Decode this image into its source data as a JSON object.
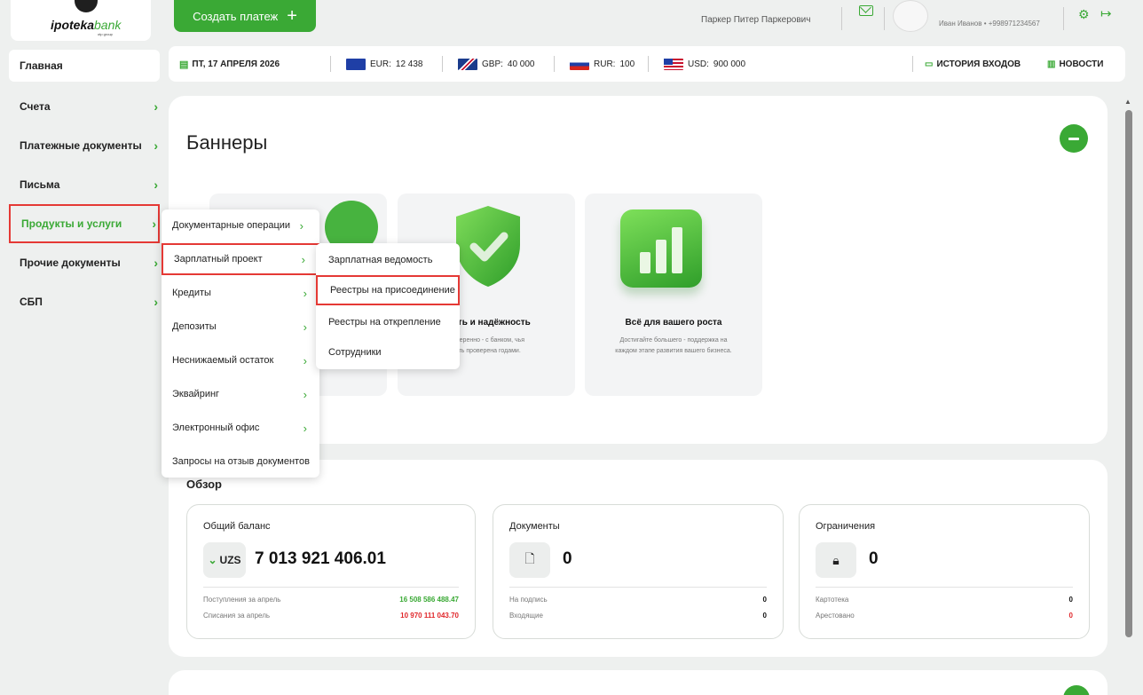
{
  "header": {
    "logo_text_bold": "ipoteka",
    "logo_text_light": "bank",
    "logo_sub": "otp group",
    "create_payment_label": "Создать платеж",
    "create_payment_icon": "plus-icon",
    "user_name": "Паркер Питер Паркерович",
    "account_line": "Иван Иванов • +998971234567"
  },
  "sidebar": {
    "main": "Главная",
    "items": [
      {
        "label": "Счета"
      },
      {
        "label": "Платежные документы"
      },
      {
        "label": "Письма"
      },
      {
        "label": "Продукты и услуги"
      },
      {
        "label": "Прочие документы"
      },
      {
        "label": "СБП"
      }
    ]
  },
  "infobar": {
    "date": "ПТ, 17 АПРЕЛЯ 2026",
    "currencies": [
      {
        "code": "EUR:",
        "value": "12 438"
      },
      {
        "code": "GBP:",
        "value": "40 000"
      },
      {
        "code": "RUR:",
        "value": "100"
      },
      {
        "code": "USD:",
        "value": "900 000"
      }
    ],
    "history_label": "ИСТОРИЯ ВХОДОВ",
    "news_label": "НОВОСТИ"
  },
  "banners": {
    "title": "Баннеры",
    "cards": [
      {
        "title": "",
        "text": ""
      },
      {
        "title": "ность и надёжность",
        "text": "ь уверенно - с банком, чья\nость проверена годами."
      },
      {
        "title": "Всё для вашего роста",
        "text": "Достигайте большего - поддержка на\nкаждом этапе развития вашего бизнеса."
      }
    ]
  },
  "overview": {
    "title": "Обзор",
    "balance": {
      "label": "Общий баланс",
      "currency": "UZS",
      "amount": "7 013 921 406.01",
      "rows": [
        {
          "label": "Поступления за апрель",
          "value": "16 508 586 488.47"
        },
        {
          "label": "Списания за апрель",
          "value": "10 970 111 043.70"
        }
      ]
    },
    "documents": {
      "label": "Документы",
      "count": "0",
      "rows": [
        {
          "label": "На подпись",
          "value": "0"
        },
        {
          "label": "Входящие",
          "value": "0"
        }
      ]
    },
    "restrictions": {
      "label": "Ограничения",
      "count": "0",
      "rows": [
        {
          "label": "Картотека",
          "value": "0"
        },
        {
          "label": "Арестовано",
          "value": "0"
        }
      ]
    }
  },
  "menu_products": {
    "items": [
      {
        "label": "Документарные операции"
      },
      {
        "label": "Зарплатный проект"
      },
      {
        "label": "Кредиты"
      },
      {
        "label": "Депозиты"
      },
      {
        "label": "Неснижаемый остаток"
      },
      {
        "label": "Эквайринг"
      },
      {
        "label": "Электронный офис"
      },
      {
        "label": "Запросы на отзыв документов"
      }
    ]
  },
  "menu_salary": {
    "items": [
      {
        "label": "Зарплатная ведомость"
      },
      {
        "label": "Реестры на присоединение"
      },
      {
        "label": "Реестры на открепление"
      },
      {
        "label": "Сотрудники"
      }
    ]
  },
  "colors": {
    "brand_green": "#3aa935",
    "highlight_red": "#e53935",
    "negative_red": "#e0262a"
  }
}
